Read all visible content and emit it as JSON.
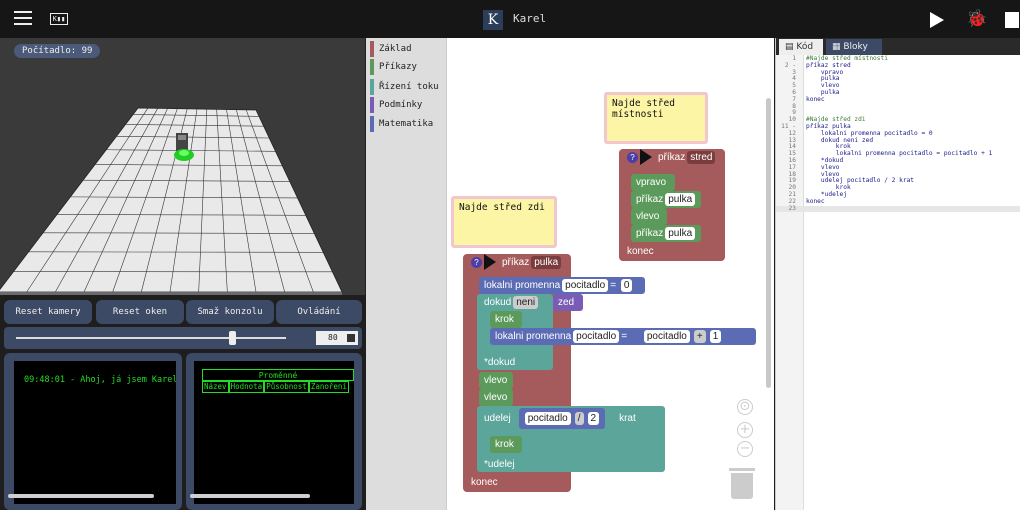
{
  "topbar": {
    "app_icon": "K▮▮",
    "logo": "K",
    "title": "Karel"
  },
  "scene": {
    "counter": "Počítadlo: 99"
  },
  "controls": {
    "buttons": [
      "Reset kamery",
      "Reset oken",
      "Smaž konzolu",
      "Ovládání"
    ],
    "speed": {
      "value": "80",
      "fraction": 0.8
    }
  },
  "console": {
    "line": "09:48:01 - Ahoj, já jsem Karel"
  },
  "variables": {
    "title": "Proměnné",
    "columns": [
      "Název",
      "Hodnota",
      "Působnost",
      "Zanoření"
    ]
  },
  "toolbox": {
    "categories": [
      {
        "label": "Základ",
        "color": "#a55b5b"
      },
      {
        "label": "Příkazy",
        "color": "#5b9a5b"
      },
      {
        "label": "Řízení toku",
        "color": "#5ba59a"
      },
      {
        "label": "Podmínky",
        "color": "#7a5bb5"
      },
      {
        "label": "Matematika",
        "color": "#5b6cb5"
      }
    ]
  },
  "workspace": {
    "note1": "Najde střed místnosti",
    "note2": "Najde střed zdi",
    "proc1": {
      "keyword": "příkaz",
      "name": "stred",
      "end": "konec",
      "body": [
        {
          "type": "cmd",
          "label": "vpravo"
        },
        {
          "type": "call",
          "label": "příkaz",
          "arg": "pulka"
        },
        {
          "type": "cmd",
          "label": "vlevo"
        },
        {
          "type": "call",
          "label": "příkaz",
          "arg": "pulka"
        }
      ]
    },
    "proc2": {
      "keyword": "příkaz",
      "name": "pulka",
      "end": "konec",
      "local1": {
        "label": "lokalni promenna",
        "var": "pocitadlo",
        "eq": "=",
        "val": "0"
      },
      "while": {
        "label": "dokud",
        "op": "neni",
        "cond": "zed",
        "end": "*dokud"
      },
      "krok1": "krok",
      "local2": {
        "label": "lokalni promenna",
        "var": "pocitadlo",
        "eq": "=",
        "var2": "pocitadlo",
        "op": "+",
        "val": "1"
      },
      "vlevo1": "vlevo",
      "vlevo2": "vlevo",
      "repeat": {
        "label": "udelej",
        "var": "pocitadlo",
        "op": "/",
        "val": "2",
        "suffix": "krat",
        "end": "*udelej"
      },
      "krok2": "krok"
    }
  },
  "editor": {
    "tab_code": "Kód",
    "tab_blocks": "Bloky",
    "lines": [
      {
        "n": "1",
        "t": "#Najde střed místnosti"
      },
      {
        "n": "2 -",
        "t": "příkaz stred"
      },
      {
        "n": "3",
        "t": "    vpravo"
      },
      {
        "n": "4",
        "t": "    pulka"
      },
      {
        "n": "5",
        "t": "    vlevo"
      },
      {
        "n": "6",
        "t": "    pulka"
      },
      {
        "n": "7",
        "t": "konec"
      },
      {
        "n": "8",
        "t": ""
      },
      {
        "n": "9",
        "t": ""
      },
      {
        "n": "10",
        "t": "#Najde střed zdi"
      },
      {
        "n": "11 -",
        "t": "příkaz pulka"
      },
      {
        "n": "12",
        "t": "    lokalni promenna pocitadlo = 0"
      },
      {
        "n": "13",
        "t": "    dokud neni zed"
      },
      {
        "n": "14",
        "t": "        krok"
      },
      {
        "n": "15",
        "t": "        lokalni promenna pocitadlo = pocitadlo + 1"
      },
      {
        "n": "16",
        "t": "    *dokud"
      },
      {
        "n": "17",
        "t": "    vlevo"
      },
      {
        "n": "18",
        "t": "    vlevo"
      },
      {
        "n": "19",
        "t": "    udelej pocitadlo / 2 krat"
      },
      {
        "n": "20",
        "t": "        krok"
      },
      {
        "n": "21",
        "t": "    *udelej"
      },
      {
        "n": "22",
        "t": "konec"
      },
      {
        "n": "23",
        "t": ""
      }
    ]
  }
}
